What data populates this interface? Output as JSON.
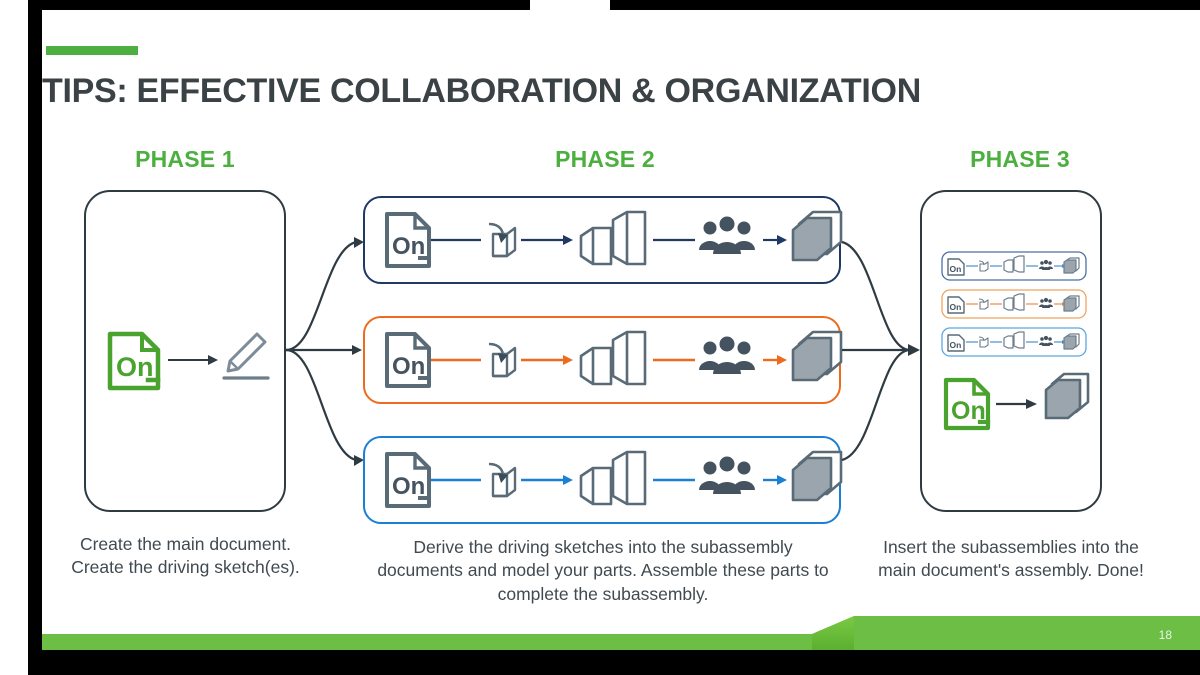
{
  "slide": {
    "title": "TIPS: EFFECTIVE COLLABORATION & ORGANIZATION",
    "number": "18"
  },
  "colors": {
    "accent_green": "#4caf3f",
    "title_gray": "#3b4246",
    "caption_gray": "#404a50",
    "frame_black": "#000000",
    "navy": "#1f3864",
    "orange": "#ed6b1f",
    "blue": "#1b7fd4",
    "icon_gray": "#5a6b78",
    "cube_fill": "#9aa5ad",
    "onshape_green": "#4ba32f"
  },
  "phases": [
    {
      "heading": "PHASE 1",
      "caption": "Create the main document.\nCreate the driving sketch(es).",
      "nodes": [
        {
          "icon": "onshape-document-icon",
          "label": "Onshape document"
        },
        {
          "icon": "pencil-sketch-icon",
          "label": "Driving sketch"
        }
      ]
    },
    {
      "heading": "PHASE 2",
      "caption": "Derive the driving sketches into the subassembly documents and model your parts. Assemble these parts to complete the subassembly.",
      "rows": [
        {
          "name": "subassembly-row-1",
          "color": "#1f3864"
        },
        {
          "name": "subassembly-row-2",
          "color": "#ed6b1f"
        },
        {
          "name": "subassembly-row-3",
          "color": "#1b7fd4"
        }
      ],
      "nodes": [
        {
          "icon": "onshape-document-icon",
          "label": "Subassembly document"
        },
        {
          "icon": "derive-icon",
          "label": "Derive"
        },
        {
          "icon": "parts-icon",
          "label": "Model parts"
        },
        {
          "icon": "collaborators-icon",
          "label": "Collaborate"
        },
        {
          "icon": "assembly-cube-icon",
          "label": "Subassembly"
        }
      ]
    },
    {
      "heading": "PHASE 3",
      "caption": "Insert the subassemblies into the main document's assembly. Done!",
      "mini_rows": [
        {
          "name": "mini-subassembly-row-1",
          "color": "#1f3864"
        },
        {
          "name": "mini-subassembly-row-2",
          "color": "#ed6b1f"
        },
        {
          "name": "mini-subassembly-row-3",
          "color": "#1b7fd4"
        }
      ],
      "nodes": [
        {
          "icon": "onshape-document-icon",
          "label": "Main document"
        },
        {
          "icon": "assembly-cube-icon",
          "label": "Main assembly"
        }
      ]
    }
  ],
  "connectors": {
    "fan_out": "Phase 1 to Phase 2 rows",
    "fan_in": "Phase 2 rows to Phase 3"
  }
}
